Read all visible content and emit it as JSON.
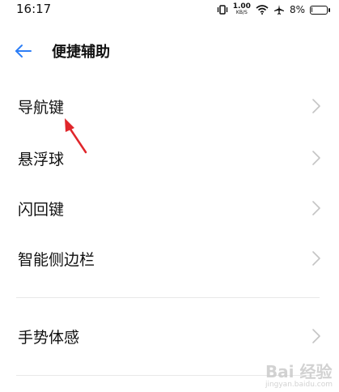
{
  "status": {
    "time": "16:17",
    "net_speed_value": "1.00",
    "net_speed_unit": "KB/S",
    "battery": "8%",
    "battery_level": 0.08,
    "icons": [
      "vibrate-icon",
      "wifi-icon",
      "airplane-icon",
      "battery-icon"
    ]
  },
  "header": {
    "title": "便捷辅助"
  },
  "items": [
    {
      "label": "导航键"
    },
    {
      "label": "悬浮球"
    },
    {
      "label": "闪回键"
    },
    {
      "label": "智能侧边栏"
    },
    {
      "label": "手势体感"
    }
  ],
  "annotation": {
    "color": "#e0262b"
  },
  "accent": "#2d7ef7",
  "watermark": {
    "brand": "Bai 经验",
    "sub": "jingyan.baidu.com"
  }
}
